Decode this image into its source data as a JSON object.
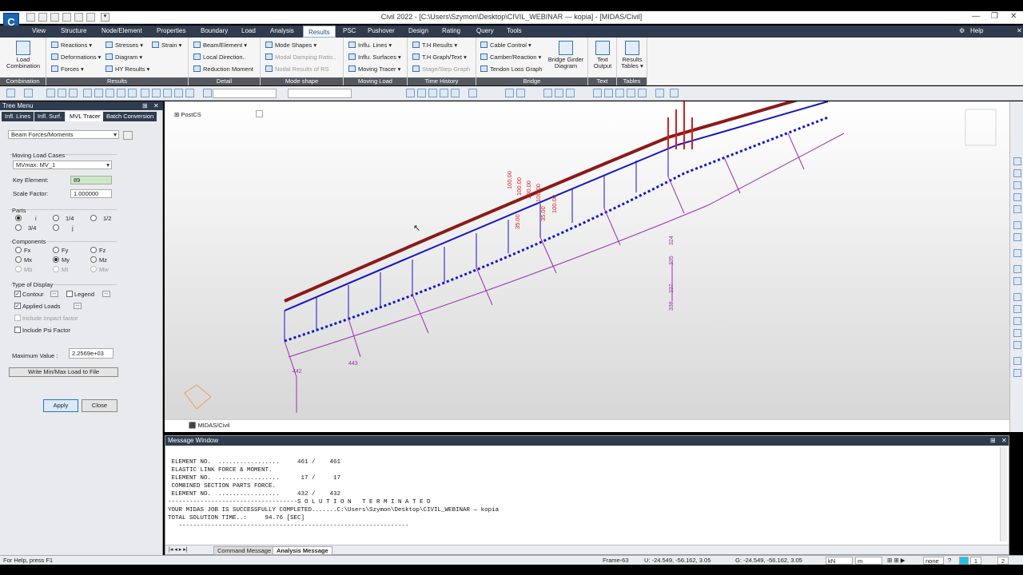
{
  "window": {
    "title": "Civil 2022 - [C:\\Users\\Szymon\\Desktop\\CIVIL_WEBINAR — kopia] - [MIDAS/Civil]",
    "app_icon": "C"
  },
  "menu": {
    "tabs": [
      "View",
      "Structure",
      "Node/Element",
      "Properties",
      "Boundary",
      "Load",
      "Analysis",
      "Results",
      "PSC",
      "Pushover",
      "Design",
      "Rating",
      "Query",
      "Tools"
    ],
    "active": "Results",
    "help": "Help"
  },
  "ribbon": {
    "groups": {
      "combination": "Combination",
      "results": "Results",
      "detail": "Detail",
      "mode_shape": "Mode shape",
      "moving_load": "Moving Load",
      "time_history": "Time History",
      "bridge": "Bridge",
      "text": "Text",
      "tables": "Tables"
    },
    "load_combination": "Load\nCombination",
    "results_items": [
      "Reactions ▾",
      "Deformations ▾",
      "Forces ▾",
      "Stresses ▾",
      "Diagram ▾",
      "HY Results ▾",
      "Strain ▾"
    ],
    "detail_items": [
      "Beam/Element ▾",
      "Local Direction..",
      "Reduction Moment"
    ],
    "mode_items": [
      "Mode Shapes ▾",
      "Modal Damping Ratio..",
      "Nodal Results of RS"
    ],
    "moving_items": [
      "Influ. Lines ▾",
      "Influ. Surfaces ▾",
      "Moving Tracer ▾"
    ],
    "time_items": [
      "T.H Results ▾",
      "T.H Graph/Text ▾",
      "Stage/Step Graph"
    ],
    "bridge_items": [
      "Cable Control ▾",
      "Camber/Reaction ▾",
      "Tendon Loss Graph"
    ],
    "bridge_girder": "Bridge Girder\nDiagram",
    "text_output": "Text\nOutput",
    "results_tables": "Results\nTables ▾"
  },
  "tree_menu": {
    "title": "Tree Menu",
    "tabs": [
      "Infl. Lines",
      "Infl. Surf.",
      "MVL Tracer",
      "Batch Conversion"
    ],
    "active_tab": "MVL Tracer",
    "type_select": "Beam Forces/Moments",
    "moving_load_cases_label": "Moving Load Cases",
    "moving_load_case": "MVmax: MV_1",
    "key_element_label": "Key Element:",
    "key_element": "89",
    "scale_factor_label": "Scale Factor:",
    "scale_factor": "1.000000",
    "parts_label": "Parts",
    "parts": [
      "i",
      "1/4",
      "1/2",
      "3/4",
      "j"
    ],
    "components_label": "Components",
    "components": [
      "Fx",
      "Fy",
      "Fz",
      "Mx",
      "My",
      "Mz",
      "Mb",
      "Mt",
      "Mw"
    ],
    "selected_component": "My",
    "type_of_display_label": "Type of Display",
    "contour": "Contour",
    "legend": "Legend",
    "applied_loads": "Applied Loads",
    "include_impact": "Include Impact factor",
    "include_psi": "Include Psi Factor",
    "max_value_label": "Maximum Value :",
    "max_value": "2.2569e+03",
    "write_button": "Write Min/Max Load to File",
    "apply": "Apply",
    "close": "Close"
  },
  "viewport": {
    "cs_label": "PostCS",
    "tab": "MIDAS/Civil",
    "load_labels": [
      "100.00",
      "100.00",
      "100.00",
      "100.00",
      "100.00",
      "35.00",
      "35.00"
    ],
    "section_labels": [
      "324",
      "335",
      "337",
      "338",
      "442",
      "443"
    ]
  },
  "message_window": {
    "title": "Message Window",
    "lines": [
      " ELEMENT NO.  .................     461 /    461",
      " ELASTIC LINK FORCE & MOMENT.",
      " ELEMENT NO.  .................      17 /     17",
      " COMBINED SECTION PARTS FORCE.",
      " ELEMENT NO.  .................     432 /    432",
      "",
      "------------------------------------S O L U T I O N   T E R M I N A T E D",
      "YOUR MIDAS JOB IS SUCCESSFULLY COMPLETED.......C:\\Users\\Szymon\\Desktop\\CIVIL_WEBINAR — kopia",
      "TOTAL SOLUTION TIME..:     94.76 [SEC]",
      "   ----------------------------------------------------------------"
    ],
    "tabs": [
      "Command Message",
      "Analysis Message"
    ],
    "active_tab": "Analysis Message"
  },
  "status": {
    "help_text": "For Help, press F1",
    "frame": "Frame-63",
    "u_coords": "U: -24.549, -56.162, 3.05",
    "g_coords": "G: -24.549, -56.162, 3.05",
    "unit_force": "kN",
    "unit_length": "m",
    "unit_other": "none",
    "page_current": "1",
    "page_total": "2"
  },
  "colors": {
    "dark_header": "#2f3b4e",
    "beam_dark_red": "#8b1a1a",
    "girder_blue": "#1414c8",
    "piers_purple": "#9a2fb0",
    "load_red": "#d81e1e"
  }
}
